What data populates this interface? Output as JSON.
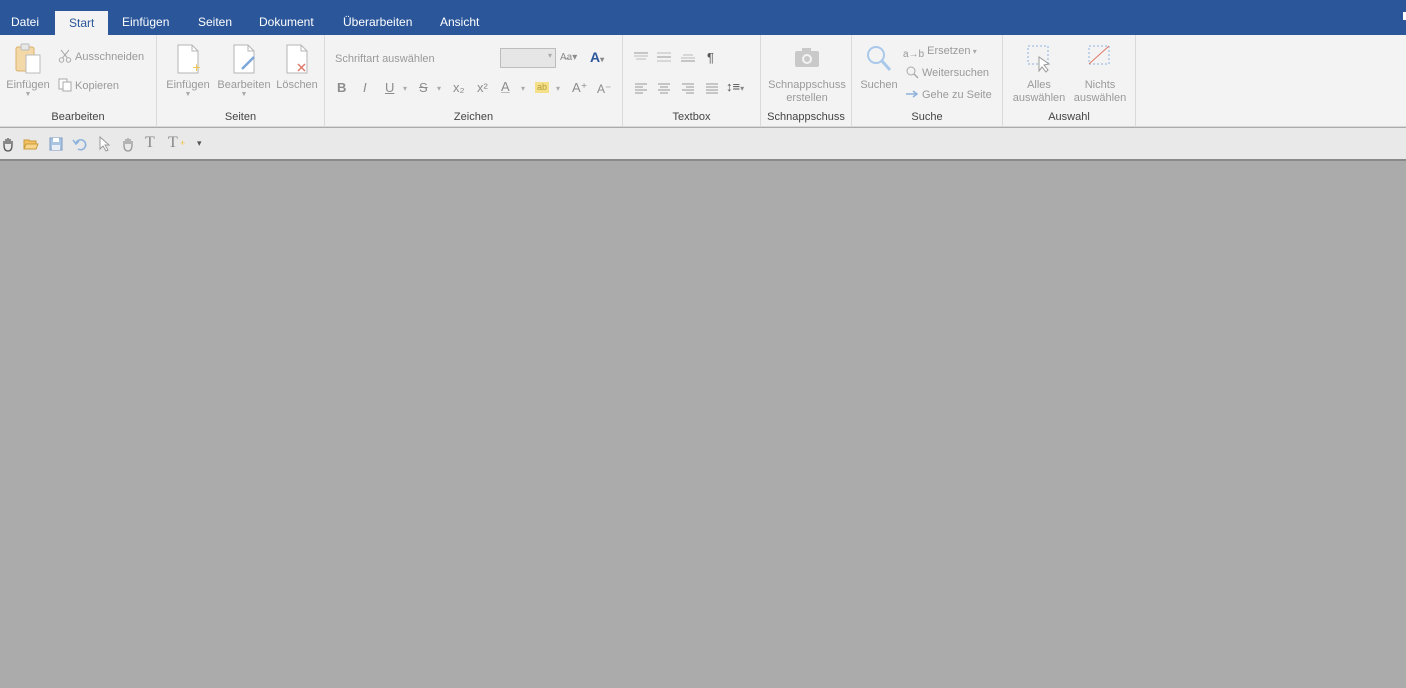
{
  "tabs": {
    "datei": "Datei",
    "start": "Start",
    "einfuegen": "Einfügen",
    "seiten": "Seiten",
    "dokument": "Dokument",
    "ueberarbeiten": "Überarbeiten",
    "ansicht": "Ansicht"
  },
  "groups": {
    "bearbeiten": {
      "label": "Bearbeiten",
      "paste": "Einfügen",
      "cut": "Ausschneiden",
      "copy": "Kopieren"
    },
    "seiten": {
      "label": "Seiten",
      "insert": "Einfügen",
      "edit": "Bearbeiten",
      "delete": "Löschen"
    },
    "zeichen": {
      "label": "Zeichen",
      "font_placeholder": "Schriftart auswählen",
      "bold": "B",
      "italic": "I",
      "underline": "U",
      "strike": "S",
      "subscript": "x₂",
      "superscript": "x²",
      "font_color": "A",
      "highlight": "ab",
      "grow": "A⁺",
      "shrink": "A⁻"
    },
    "textbox": {
      "label": "Textbox",
      "pilcrow": "¶"
    },
    "schnappschuss": {
      "label": "Schnappschuss",
      "create_line1": "Schnappschuss",
      "create_line2": "erstellen"
    },
    "suche": {
      "label": "Suche",
      "search": "Suchen",
      "replace": "Ersetzen",
      "find_next": "Weitersuchen",
      "goto_page": "Gehe zu Seite"
    },
    "auswahl": {
      "label": "Auswahl",
      "select_all_line1": "Alles",
      "select_all_line2": "auswählen",
      "select_none_line1": "Nichts",
      "select_none_line2": "auswählen"
    }
  },
  "qat": {
    "text_tool": "T",
    "text_add_tool": "T"
  },
  "colors": {
    "accent": "#2b579a",
    "ribbon": "#f3f3f3",
    "canvas": "#ababab"
  }
}
